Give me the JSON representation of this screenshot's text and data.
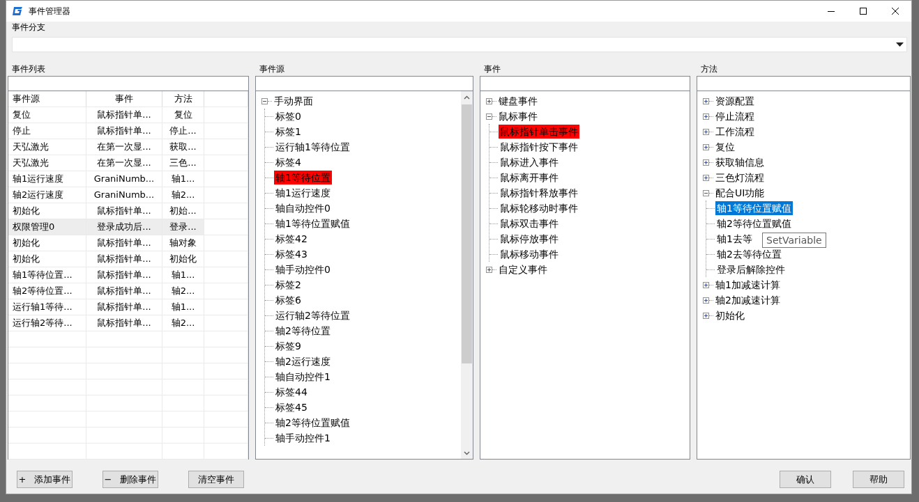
{
  "window": {
    "title": "事件管理器"
  },
  "branch": {
    "label": "事件分支"
  },
  "event_list": {
    "label": "事件列表",
    "columns": [
      "事件源",
      "事件",
      "方法"
    ],
    "rows": [
      {
        "source": "复位",
        "event": "鼠标指针单...",
        "method": "复位",
        "selected": false
      },
      {
        "source": "停止",
        "event": "鼠标指针单...",
        "method": "停止...",
        "selected": false
      },
      {
        "source": "天弘激光",
        "event": "在第一次显...",
        "method": "获取...",
        "selected": false
      },
      {
        "source": "天弘激光",
        "event": "在第一次显...",
        "method": "三色...",
        "selected": false
      },
      {
        "source": "轴1运行速度",
        "event": "GraniNumb...",
        "method": "轴1...",
        "selected": false
      },
      {
        "source": "轴2运行速度",
        "event": "GraniNumb...",
        "method": "轴2...",
        "selected": false
      },
      {
        "source": "初始化",
        "event": "鼠标指针单...",
        "method": "初始...",
        "selected": false
      },
      {
        "source": "权限管理0",
        "event": "登录成功后...",
        "method": "登录...",
        "selected": true
      },
      {
        "source": "初始化",
        "event": "鼠标指针单...",
        "method": "轴对象",
        "selected": false
      },
      {
        "source": "初始化",
        "event": "鼠标指针单...",
        "method": "初始化",
        "selected": false
      },
      {
        "source": "轴1等待位置...",
        "event": "鼠标指针单...",
        "method": "轴1...",
        "selected": false
      },
      {
        "source": "轴2等待位置...",
        "event": "鼠标指针单...",
        "method": "轴2...",
        "selected": false
      },
      {
        "source": "运行轴1等待...",
        "event": "鼠标指针单...",
        "method": "轴1...",
        "selected": false
      },
      {
        "source": "运行轴2等待...",
        "event": "鼠标指针单...",
        "method": "轴2...",
        "selected": false
      }
    ]
  },
  "sources": {
    "label": "事件源",
    "tree": [
      {
        "label": "手动界面",
        "expanded": true,
        "selected": false,
        "marked": false,
        "children": [
          {
            "label": "标签0",
            "selected": false,
            "marked": false
          },
          {
            "label": "标签1",
            "selected": false,
            "marked": false
          },
          {
            "label": "运行轴1等待位置",
            "selected": false,
            "marked": false
          },
          {
            "label": "标签4",
            "selected": false,
            "marked": false
          },
          {
            "label": "轴1等待位置",
            "selected": false,
            "marked": true
          },
          {
            "label": "轴1运行速度",
            "selected": false,
            "marked": false
          },
          {
            "label": "轴自动控件0",
            "selected": false,
            "marked": false
          },
          {
            "label": "轴1等待位置赋值",
            "selected": false,
            "marked": false
          },
          {
            "label": "标签42",
            "selected": false,
            "marked": false
          },
          {
            "label": "标签43",
            "selected": false,
            "marked": false
          },
          {
            "label": "轴手动控件0",
            "selected": false,
            "marked": false
          },
          {
            "label": "标签2",
            "selected": false,
            "marked": false
          },
          {
            "label": "标签6",
            "selected": false,
            "marked": false
          },
          {
            "label": "运行轴2等待位置",
            "selected": false,
            "marked": false
          },
          {
            "label": "轴2等待位置",
            "selected": false,
            "marked": false
          },
          {
            "label": "标签9",
            "selected": false,
            "marked": false
          },
          {
            "label": "轴2运行速度",
            "selected": false,
            "marked": false
          },
          {
            "label": "轴自动控件1",
            "selected": false,
            "marked": false
          },
          {
            "label": "标签44",
            "selected": false,
            "marked": false
          },
          {
            "label": "标签45",
            "selected": false,
            "marked": false
          },
          {
            "label": "轴2等待位置赋值",
            "selected": false,
            "marked": false
          },
          {
            "label": "轴手动控件1",
            "selected": false,
            "marked": false
          }
        ]
      }
    ]
  },
  "events": {
    "label": "事件",
    "tree": [
      {
        "label": "键盘事件",
        "expanded": false,
        "selected": false,
        "marked": false
      },
      {
        "label": "鼠标事件",
        "expanded": true,
        "selected": false,
        "marked": false,
        "children": [
          {
            "label": "鼠标指针单击事件",
            "selected": false,
            "marked": true
          },
          {
            "label": "鼠标指针按下事件",
            "selected": false,
            "marked": false
          },
          {
            "label": "鼠标进入事件",
            "selected": false,
            "marked": false
          },
          {
            "label": "鼠标离开事件",
            "selected": false,
            "marked": false
          },
          {
            "label": "鼠标指针释放事件",
            "selected": false,
            "marked": false
          },
          {
            "label": "鼠标轮移动时事件",
            "selected": false,
            "marked": false
          },
          {
            "label": "鼠标双击事件",
            "selected": false,
            "marked": false
          },
          {
            "label": "鼠标停放事件",
            "selected": false,
            "marked": false
          },
          {
            "label": "鼠标移动事件",
            "selected": false,
            "marked": false
          }
        ]
      },
      {
        "label": "自定义事件",
        "expanded": false,
        "selected": false,
        "marked": false
      }
    ]
  },
  "methods": {
    "label": "方法",
    "tooltip": "SetVariable",
    "tree": [
      {
        "label": "资源配置",
        "expanded": false,
        "selected": false,
        "marked": false
      },
      {
        "label": "停止流程",
        "expanded": false,
        "selected": false,
        "marked": false
      },
      {
        "label": "工作流程",
        "expanded": false,
        "selected": false,
        "marked": false
      },
      {
        "label": "复位",
        "expanded": false,
        "selected": false,
        "marked": false
      },
      {
        "label": "获取轴信息",
        "expanded": false,
        "selected": false,
        "marked": false
      },
      {
        "label": "三色灯流程",
        "expanded": false,
        "selected": false,
        "marked": false
      },
      {
        "label": "配合UI功能",
        "expanded": true,
        "selected": false,
        "marked": false,
        "children": [
          {
            "label": "轴1等待位置赋值",
            "selected": true,
            "marked": false
          },
          {
            "label": "轴2等待位置赋值",
            "selected": false,
            "marked": false
          },
          {
            "label": "轴1去等",
            "selected": false,
            "marked": false
          },
          {
            "label": "轴2去等待位置",
            "selected": false,
            "marked": false
          },
          {
            "label": "登录后解除控件",
            "selected": false,
            "marked": false
          }
        ]
      },
      {
        "label": "轴1加减速计算",
        "expanded": false,
        "selected": false,
        "marked": false
      },
      {
        "label": "轴2加减速计算",
        "expanded": false,
        "selected": false,
        "marked": false
      },
      {
        "label": "初始化",
        "expanded": false,
        "selected": false,
        "marked": false
      }
    ]
  },
  "buttons_left": [
    {
      "label": "添加事件",
      "symbol": "+"
    },
    {
      "label": "删除事件",
      "symbol": "−"
    },
    {
      "label": "清空事件"
    }
  ],
  "buttons_right": [
    "确认",
    "帮助"
  ]
}
